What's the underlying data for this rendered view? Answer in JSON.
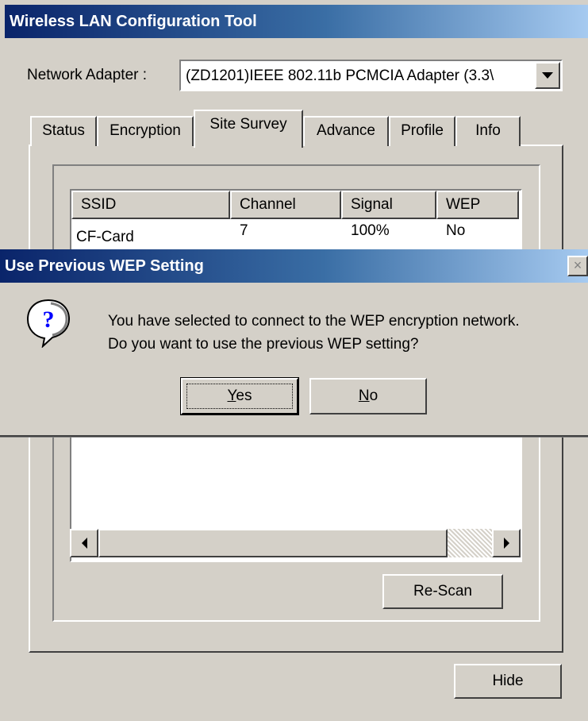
{
  "window": {
    "title": "Wireless LAN Configuration Tool"
  },
  "adapter": {
    "label": "Network Adapter :",
    "value": "(ZD1201)IEEE 802.11b PCMCIA Adapter (3.3\\"
  },
  "tabs": [
    {
      "label": "Status"
    },
    {
      "label": "Encryption"
    },
    {
      "label": "Site Survey"
    },
    {
      "label": "Advance"
    },
    {
      "label": "Profile"
    },
    {
      "label": "Info"
    }
  ],
  "active_tab": "Site Survey",
  "survey": {
    "columns": [
      "SSID",
      "Channel",
      "Signal",
      "WEP"
    ],
    "rows": [
      {
        "ssid": "CF-Card",
        "channel": "7",
        "signal": "100%",
        "wep": "No"
      }
    ],
    "rescan_label": "Re-Scan"
  },
  "hide_label": "Hide",
  "dialog": {
    "title": "Use Previous WEP Setting",
    "close_glyph": "×",
    "icon_glyph": "?",
    "message_line1": "You have selected to connect to the WEP encryption network.",
    "message_line2": "Do you want to use the previous WEP setting?",
    "yes_mnemonic": "Y",
    "yes_rest": "es",
    "no_mnemonic": "N",
    "no_rest": "o"
  },
  "colors": {
    "title_start": "#0a246a",
    "title_end": "#a6caf0",
    "face": "#d4d0c8",
    "icon_blue": "#0000ff"
  }
}
